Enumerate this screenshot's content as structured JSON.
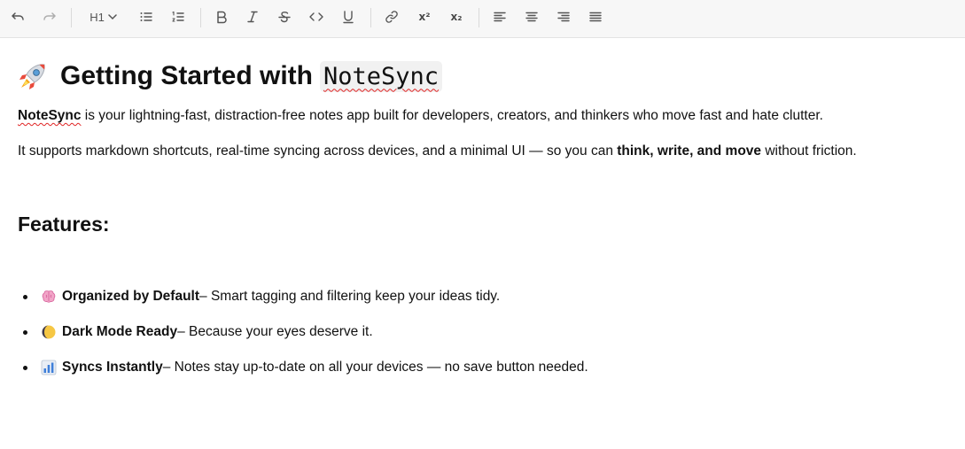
{
  "toolbar": {
    "heading_value": "H1",
    "superscript_label": "x²",
    "subscript_label": "x₂",
    "icons": [
      "undo-icon",
      "redo-icon",
      "heading-select",
      "bullet-list-icon",
      "ordered-list-icon",
      "bold-icon",
      "italic-icon",
      "strikethrough-icon",
      "code-icon",
      "underline-icon",
      "link-icon",
      "superscript-icon",
      "subscript-icon",
      "align-left-icon",
      "align-center-icon",
      "align-right-icon",
      "align-justify-icon"
    ]
  },
  "document": {
    "title_emoji": "rocket-icon",
    "title_text": "Getting Started with",
    "title_code": "NoteSync",
    "intro_brand": "NoteSync",
    "intro_rest": " is your lightning-fast, distraction-free notes app built for developers, creators, and thinkers who move fast and hate clutter.",
    "support_pre": "It supports markdown shortcuts, real-time syncing across devices, and a minimal UI — so you can ",
    "support_bold": "think, write, and move",
    "support_post": " without friction.",
    "features_heading": "Features:",
    "features": [
      {
        "icon": "brain-icon",
        "title": "Organized by Default",
        "desc": " – Smart tagging and filtering keep your ideas tidy."
      },
      {
        "icon": "moon-icon",
        "title": "Dark Mode Ready",
        "desc": " – Because your eyes deserve it."
      },
      {
        "icon": "bar-chart-icon",
        "title": "Syncs Instantly",
        "desc": " – Notes stay up-to-date on all your devices — no save button needed."
      }
    ]
  },
  "colors": {
    "toolbar_bg": "#f7f7f7",
    "icon": "#4a4a4a",
    "spellcheck": "#e02424"
  }
}
